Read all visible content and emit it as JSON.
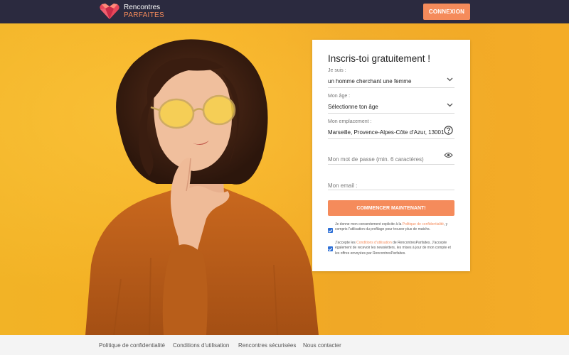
{
  "header": {
    "logo_line1": "Rencontres",
    "logo_line2": "PARFAITES",
    "login_label": "CONNEXION"
  },
  "form": {
    "title": "Inscris-toi gratuitement !",
    "seeking": {
      "label": "Je suis :",
      "value": "un homme cherchant une femme"
    },
    "age": {
      "label": "Mon âge :",
      "value": "Sélectionne ton âge"
    },
    "location": {
      "label": "Mon emplacement :",
      "value": "Marseille, Provence-Alpes-Côte d'Azur, 13001"
    },
    "password": {
      "placeholder": "Mon mot de passe (min. 6 caractères)"
    },
    "email": {
      "placeholder": "Mon email :"
    },
    "submit_label": "COMMENCER MAINTENANT!",
    "consent1": {
      "checked": true,
      "text_before": "Je donne mon consentement explicite à la ",
      "link": "Politique de confidentialité",
      "text_after": ", y compris l'utilisation du profilage pour trouver plus de matchs."
    },
    "consent2": {
      "checked": true,
      "text_before": "J'accepte les ",
      "link": "Conditions d'utilisation",
      "text_after": " de RencontresParfaites. J'accepte également de recevoir les newsletters, les mises à jour de mon compte et les offres envoyées par RencontresParfaites."
    }
  },
  "footer": {
    "links": [
      "Politique de confidentialité",
      "Conditions d'utilisation",
      "Rencontres sécurisées",
      "Nous contacter"
    ]
  },
  "colors": {
    "accent": "#f58b5b",
    "header_bg": "#2b2a3f",
    "hero_bg": "#f2b326",
    "checkbox": "#2d6fd6"
  },
  "icons": [
    "heart-logo-icon",
    "chevron-down-icon",
    "help-circle-icon",
    "eye-icon"
  ]
}
